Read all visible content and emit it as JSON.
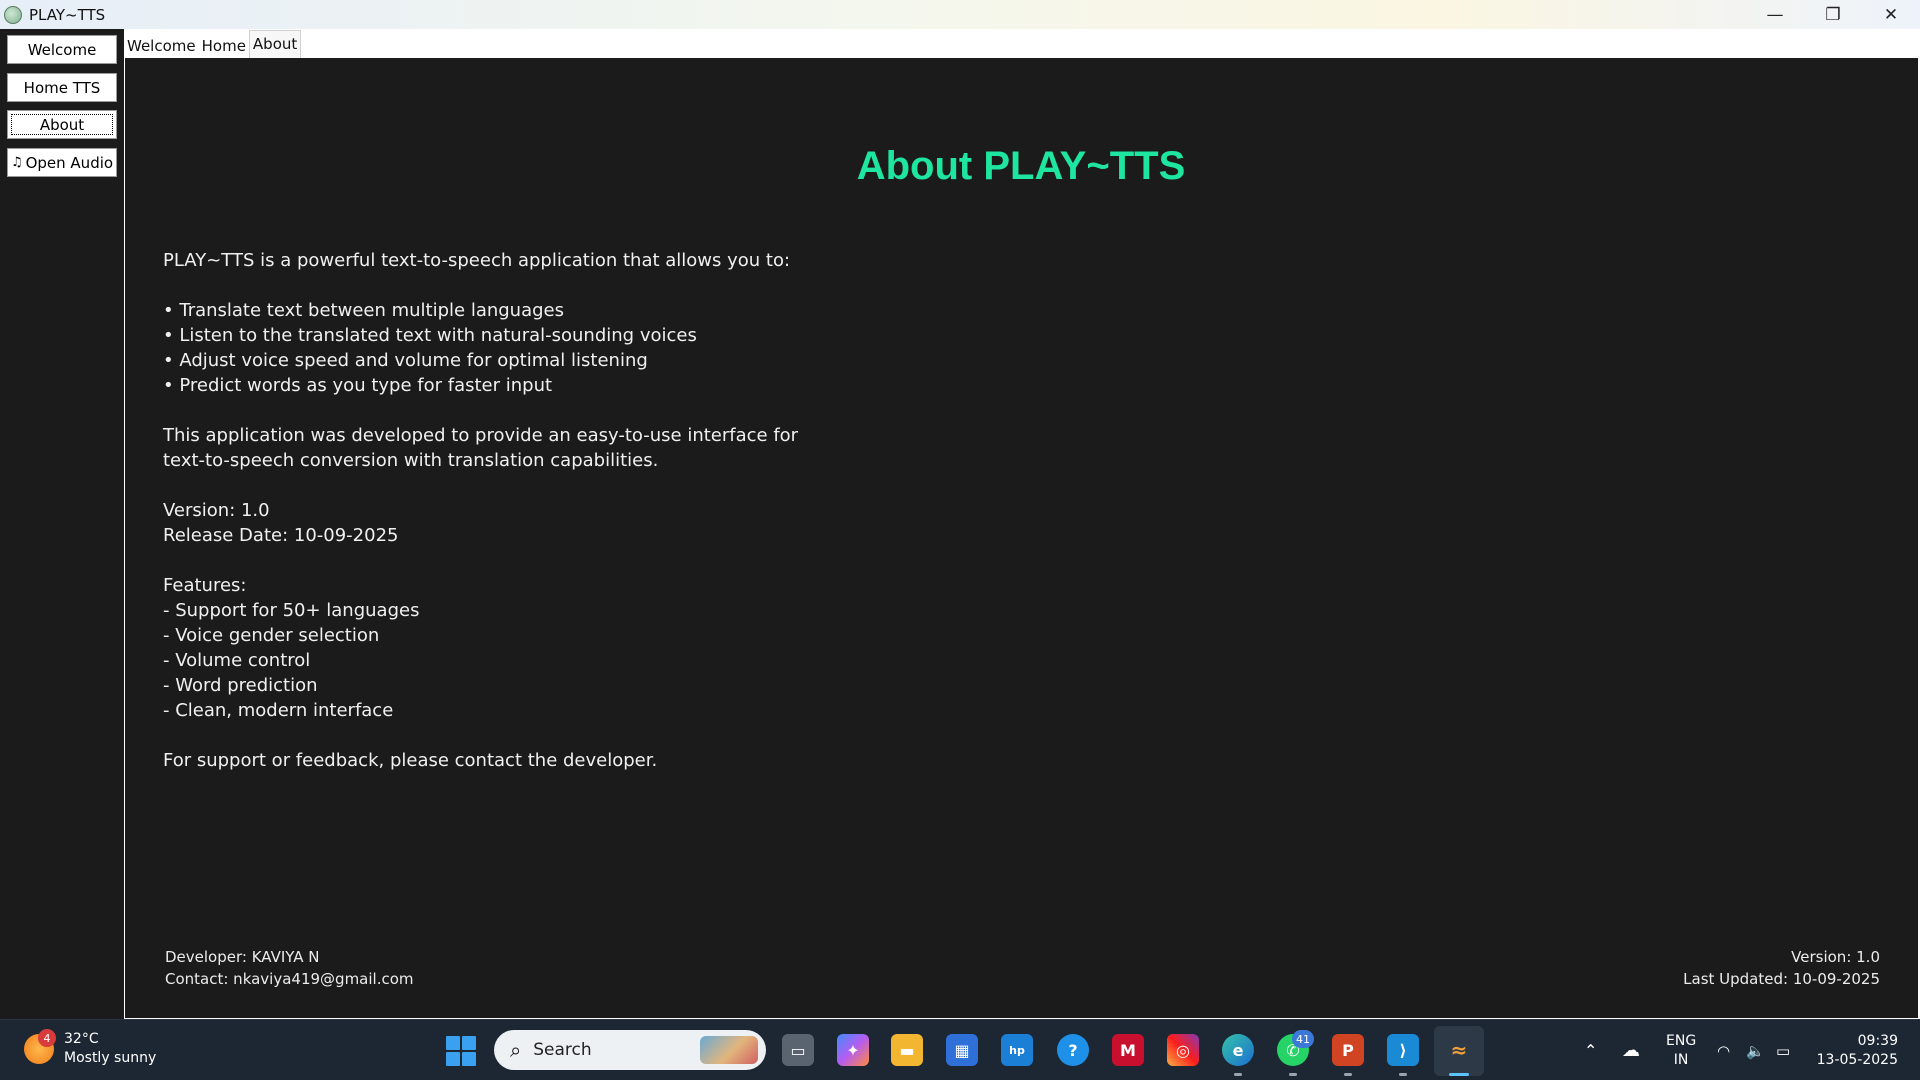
{
  "window": {
    "title": "PLAY~TTS",
    "controls": {
      "minimize": "—",
      "restore": "❐",
      "close": "✕"
    }
  },
  "sidebar": {
    "items": [
      {
        "label": "Welcome"
      },
      {
        "label": "Home TTS"
      },
      {
        "label": "About"
      },
      {
        "label": "Open Audio",
        "icon": "♫"
      }
    ]
  },
  "tabs": [
    {
      "label": "Welcome"
    },
    {
      "label": "Home"
    },
    {
      "label": "About"
    }
  ],
  "about": {
    "title": "About PLAY~TTS",
    "body": "PLAY~TTS is a powerful text-to-speech application that allows you to:\n\n• Translate text between multiple languages\n• Listen to the translated text with natural-sounding voices\n• Adjust voice speed and volume for optimal listening\n• Predict words as you type for faster input\n\nThis application was developed to provide an easy-to-use interface for\ntext-to-speech conversion with translation capabilities.\n\nVersion: 1.0\nRelease Date: 10-09-2025\n\nFeatures:\n- Support for 50+ languages\n- Voice gender selection\n- Volume control\n- Word prediction\n- Clean, modern interface\n\nFor support or feedback, please contact the developer.",
    "title_color": "#1ee6a0",
    "footer": {
      "developer": "Developer: KAVIYA N",
      "contact": "Contact: nkaviya419@gmail.com",
      "version": "Version: 1.0",
      "last_updated": "Last Updated: 10-09-2025"
    }
  },
  "taskbar": {
    "weather": {
      "temp": "32°C",
      "condition": "Mostly sunny",
      "badge": "4"
    },
    "search_label": "Search",
    "whatsapp_badge": "41",
    "tray": {
      "language": "ENG",
      "region": "IN",
      "time": "09:39",
      "date": "13-05-2025"
    }
  }
}
